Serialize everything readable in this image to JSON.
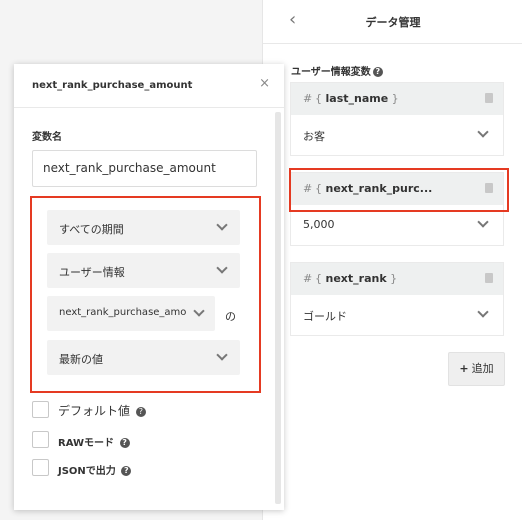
{
  "data_panel": {
    "title": "データ管理",
    "back_icon": "chevron-left-icon",
    "section_label": "ユーザー情報変数",
    "variables": [
      {
        "hash": "#",
        "name": "last_name",
        "value": "お客"
      },
      {
        "hash": "#",
        "name": "next_rank_purc...",
        "value": "5,000"
      },
      {
        "hash": "#",
        "name": "next_rank",
        "value": "ゴールド"
      }
    ],
    "add_button": "追加"
  },
  "modal": {
    "title": "next_rank_purchase_amount",
    "close": "×",
    "variable_name_label": "変数名",
    "variable_name_value": "next_rank_purchase_amount",
    "selects": {
      "period": "すべての期間",
      "source": "ユーザー情報",
      "field": "next_rank_purchase_amo",
      "no": "の",
      "aggregate": "最新の値"
    },
    "checkboxes": {
      "default_value": "デフォルト値",
      "raw_mode": "RAWモード",
      "json_output": "JSONで出力"
    }
  },
  "colors": {
    "highlight": "#e53a22"
  }
}
